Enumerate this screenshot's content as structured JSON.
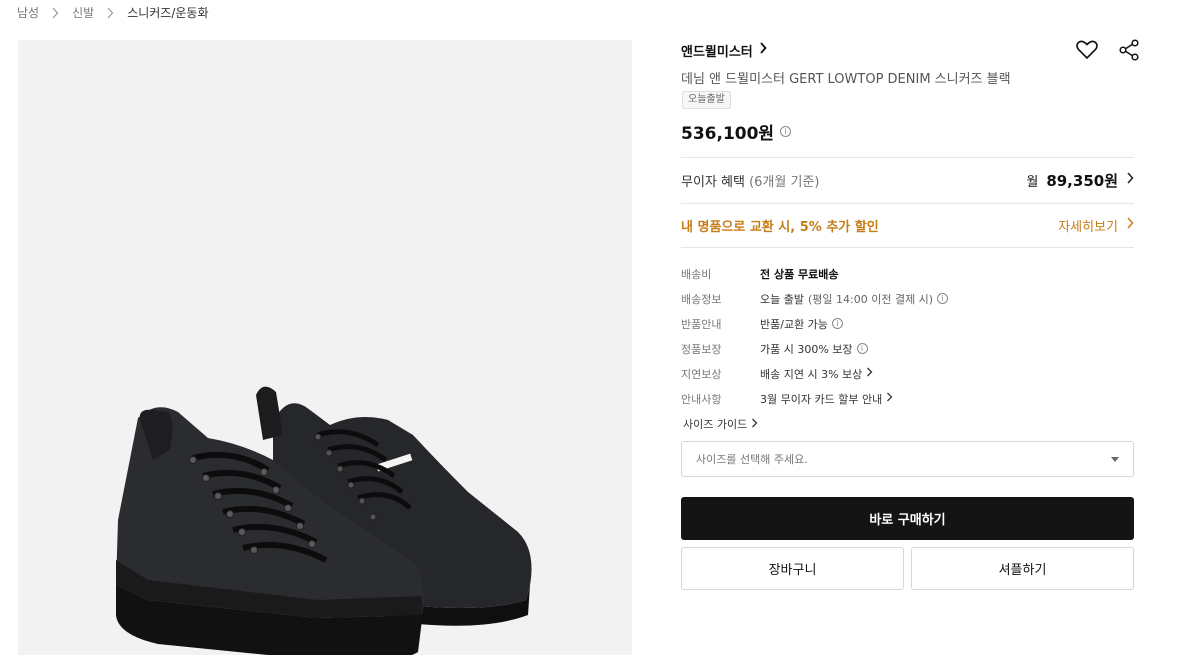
{
  "breadcrumb": [
    "남성",
    "신발",
    "스니커즈/운동화"
  ],
  "brand": {
    "name": "앤드뮐미스터"
  },
  "product": {
    "name": "데님 앤 드뮐미스터 GERT LOWTOP DENIM 스니커즈 블랙",
    "badge": "오늘출발",
    "price": "536,100원"
  },
  "installment": {
    "label": "무이자 혜택",
    "note": "(6개월 기준)",
    "prefix": "월",
    "amount": "89,350원"
  },
  "promo": {
    "text": "내 명품으로 교환 시, 5% 추가 할인",
    "link": "자세히보기"
  },
  "details": [
    {
      "label": "배송비",
      "value": "전 상품 무료배송"
    },
    {
      "label": "배송정보",
      "value": "오늘 출발",
      "note": "(평일 14:00 이전 결제 시)"
    },
    {
      "label": "반품안내",
      "value": "반품/교환 가능"
    },
    {
      "label": "정품보장",
      "value": "가품 시 300% 보장"
    },
    {
      "label": "지연보상",
      "value": "배송 지연 시 3% 보상"
    },
    {
      "label": "안내사항",
      "value": "3월 무이자 카드 할부 안내"
    }
  ],
  "size_guide": "사이즈 가이드",
  "size_select": {
    "placeholder": "사이즈를 선택해 주세요."
  },
  "buttons": {
    "buy": "바로 구매하기",
    "cart": "장바구니",
    "share": "셔플하기"
  },
  "colors": {
    "accent": "#c87d17",
    "primary_button": "#141414",
    "image_bg": "#f2f2f2"
  },
  "icons": [
    "chevron-right-icon",
    "heart-icon",
    "share-icon",
    "info-icon",
    "caret-down-icon"
  ]
}
